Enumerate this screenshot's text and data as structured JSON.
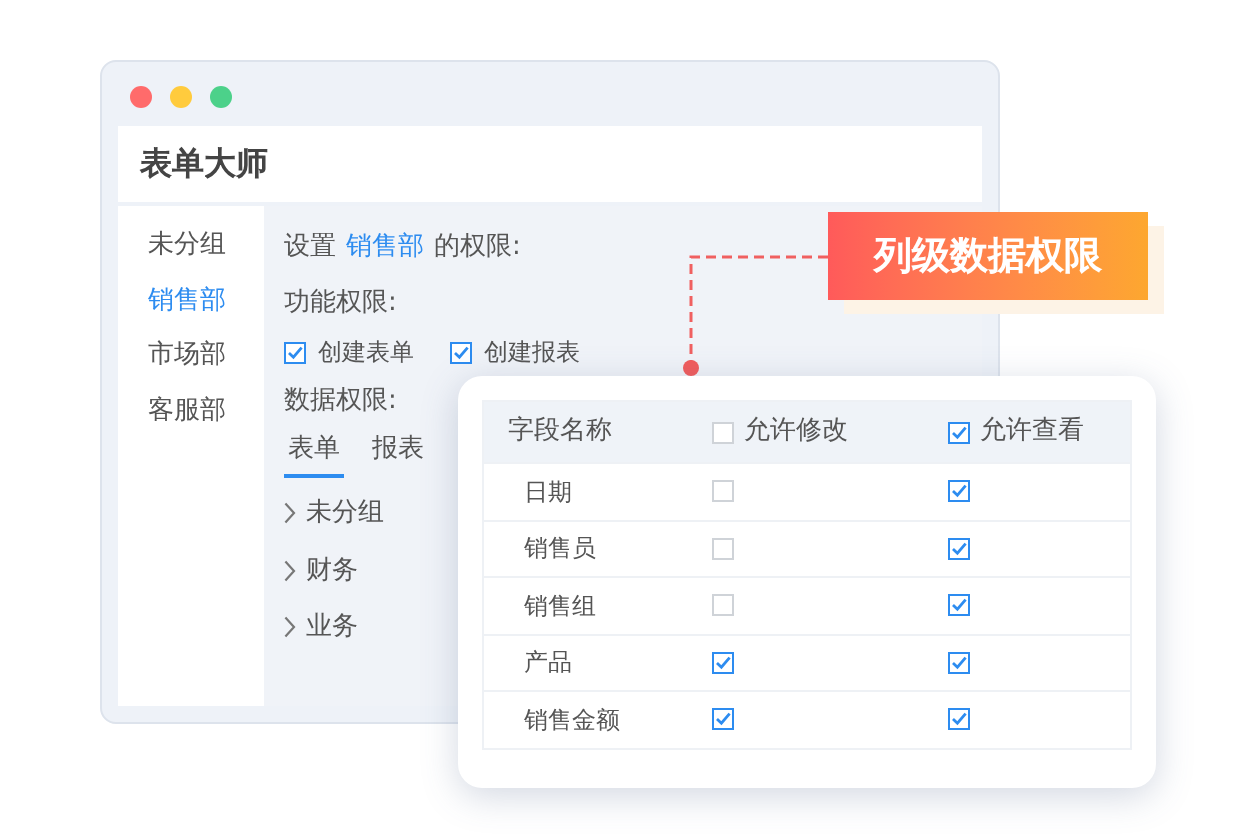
{
  "window": {
    "title": "表单大师"
  },
  "sidebar": {
    "items": [
      {
        "label": "未分组",
        "selected": false
      },
      {
        "label": "销售部",
        "selected": true
      },
      {
        "label": "市场部",
        "selected": false
      },
      {
        "label": "客服部",
        "selected": false
      }
    ]
  },
  "heading": {
    "prefix": "设置",
    "department": "销售部",
    "suffix": "的权限:"
  },
  "function_permissions": {
    "label": "功能权限:",
    "options": [
      {
        "label": "创建表单",
        "checked": true
      },
      {
        "label": "创建报表",
        "checked": true
      }
    ]
  },
  "data_permissions": {
    "label": "数据权限:",
    "tabs": [
      {
        "label": "表单",
        "selected": true
      },
      {
        "label": "报表",
        "selected": false
      }
    ],
    "groups": [
      {
        "label": "未分组"
      },
      {
        "label": "财务"
      },
      {
        "label": "业务"
      }
    ]
  },
  "callout": {
    "label": "列级数据权限"
  },
  "table": {
    "columns": [
      {
        "kind": "text",
        "label": "字段名称"
      },
      {
        "kind": "checkbox",
        "label": "允许修改",
        "checked": false
      },
      {
        "kind": "checkbox",
        "label": "允许查看",
        "checked": true
      }
    ],
    "rows": [
      {
        "field": "日期",
        "can_edit": false,
        "can_view": true
      },
      {
        "field": "销售员",
        "can_edit": false,
        "can_view": true
      },
      {
        "field": "销售组",
        "can_edit": false,
        "can_view": true
      },
      {
        "field": "产品",
        "can_edit": true,
        "can_view": true
      },
      {
        "field": "销售金额",
        "can_edit": true,
        "can_view": true
      }
    ]
  }
}
